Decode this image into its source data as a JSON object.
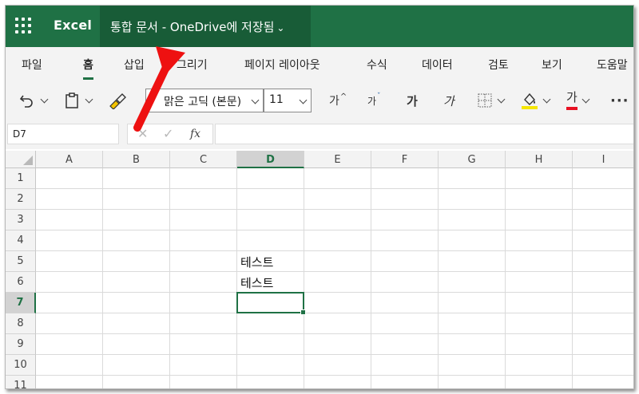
{
  "app": {
    "brand": "Excel",
    "document_title": "통합 문서 - OneDrive에 저장됨"
  },
  "tabs": [
    "파일",
    "홈",
    "삽입",
    "그리기",
    "페이지 레이아웃",
    "수식",
    "데이터",
    "검토",
    "보기",
    "도움말"
  ],
  "active_tab": "홈",
  "ribbon": {
    "font_name": "맑은 고딕 (본문)",
    "font_size": "11",
    "grow_font": "가",
    "shrink_font": "가",
    "bold": "가",
    "italic": "가",
    "font_color_glyph": "가",
    "more": "···",
    "colors": {
      "highlight": "#f5e600",
      "font_color": "#e81123",
      "accent": "#1f7145"
    }
  },
  "formula_bar": {
    "name_box": "D7",
    "fx": "fx",
    "cancel": "✕",
    "confirm": "✓",
    "content": ""
  },
  "grid": {
    "columns": [
      "A",
      "B",
      "C",
      "D",
      "E",
      "F",
      "G",
      "H",
      "I"
    ],
    "rows": [
      "1",
      "2",
      "3",
      "4",
      "5",
      "6",
      "7",
      "8",
      "9",
      "10",
      "11"
    ],
    "selected_column": "D",
    "selected_row": "7",
    "cells": [
      {
        "ref": "D5",
        "value": "테스트"
      },
      {
        "ref": "D6",
        "value": "테스트"
      }
    ],
    "active_cell": "D7"
  },
  "icons": [
    "waffle-icon",
    "undo-icon",
    "clipboard-icon",
    "format-painter-icon",
    "borders-icon",
    "fill-color-icon",
    "font-color-icon",
    "cancel-icon",
    "confirm-icon",
    "fx-icon"
  ]
}
